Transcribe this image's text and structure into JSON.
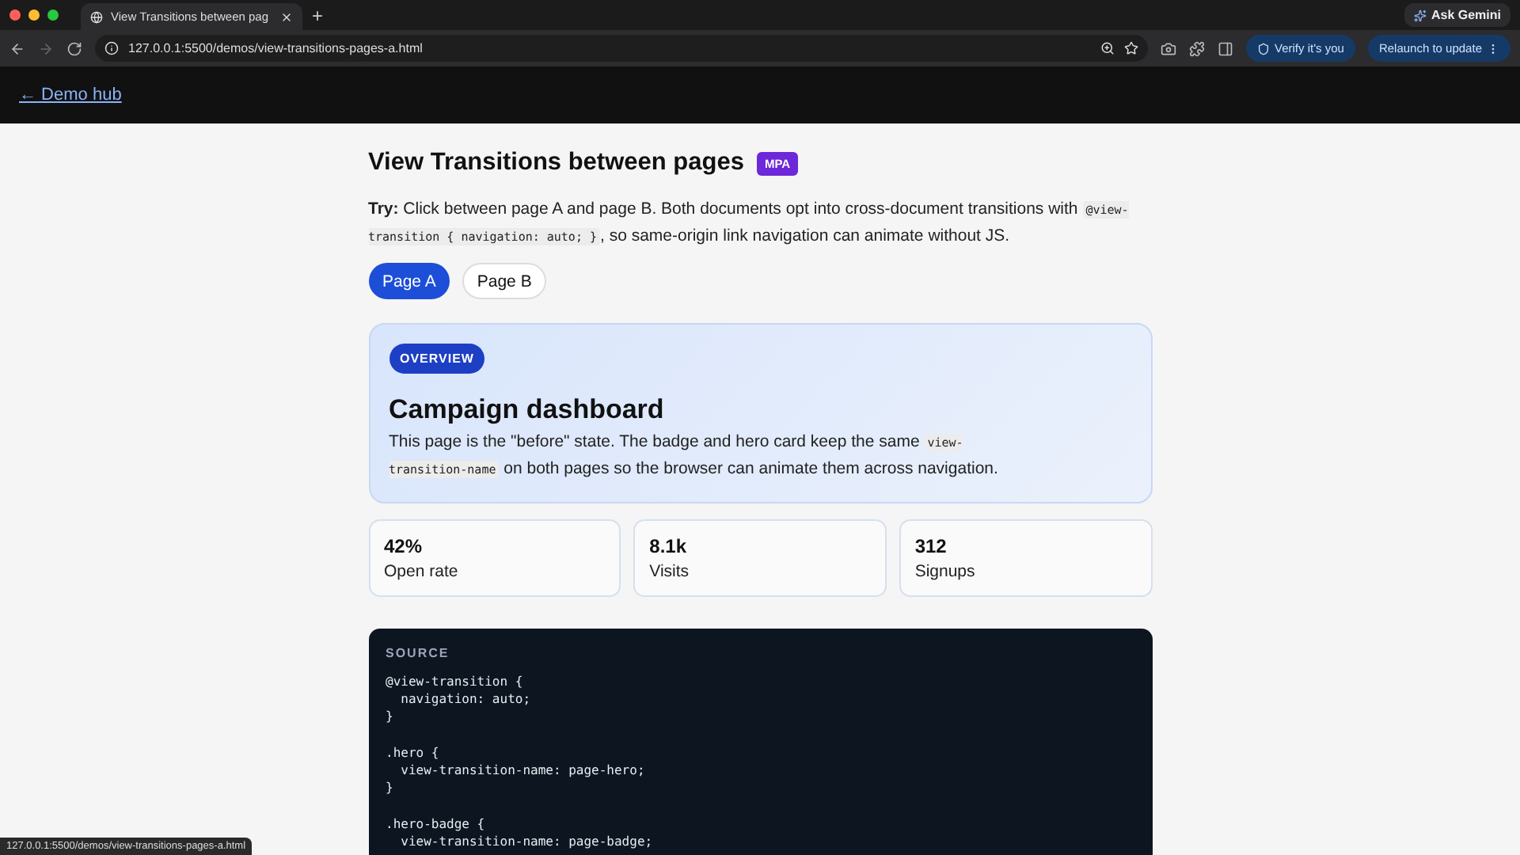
{
  "browser": {
    "tab_title": "View Transitions between pag",
    "new_tab": "+",
    "url": "127.0.0.1:5500/demos/view-transitions-pages-a.html",
    "ask_gemini": "Ask Gemini",
    "verify": "Verify it's you",
    "relaunch": "Relaunch to update"
  },
  "header": {
    "back_link": "← Demo hub"
  },
  "page": {
    "title": "View Transitions between pages",
    "badge": "MPA",
    "intro": [
      {
        "kind": "bold",
        "text": "Try:"
      },
      {
        "kind": "text",
        "text": " Click between page A and page B. Both documents opt into cross-document transitions with "
      },
      {
        "kind": "code",
        "text": "@view-transition { navigation: auto; }"
      },
      {
        "kind": "text",
        "text": ", so same-origin link navigation can animate without JS."
      }
    ],
    "page_links": [
      {
        "label": "Page A",
        "selected": true
      },
      {
        "label": "Page B",
        "selected": false
      }
    ],
    "hero": {
      "badge": "OVERVIEW",
      "title": "Campaign dashboard",
      "body": [
        {
          "kind": "text",
          "text": "This page is the \"before\" state. The badge and hero card keep the same "
        },
        {
          "kind": "code",
          "text": "view-transition-name"
        },
        {
          "kind": "text",
          "text": " on both pages so the browser can animate them across navigation."
        }
      ]
    },
    "stats": [
      {
        "value": "42%",
        "label": "Open rate"
      },
      {
        "value": "8.1k",
        "label": "Visits"
      },
      {
        "value": "312",
        "label": "Signups"
      }
    ],
    "source": {
      "label": "SOURCE",
      "code": "@view-transition {\n  navigation: auto;\n}\n\n.hero {\n  view-transition-name: page-hero;\n}\n\n.hero-badge {\n  view-transition-name: page-badge;"
    }
  },
  "status_url": "127.0.0.1:5500/demos/view-transitions-pages-a.html"
}
